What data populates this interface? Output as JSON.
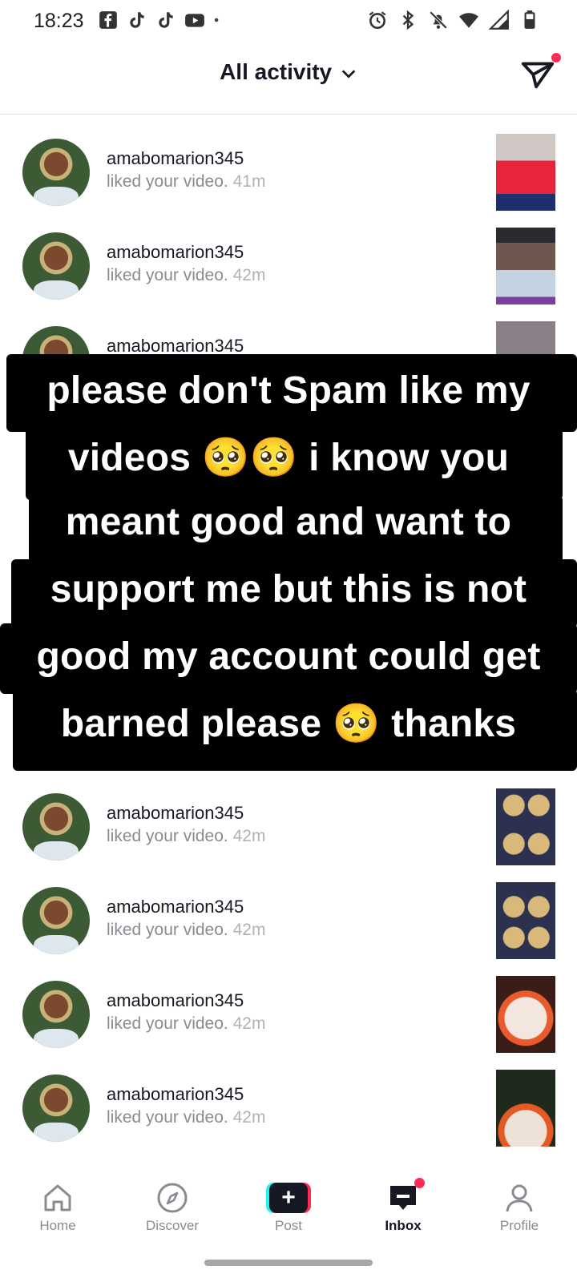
{
  "status": {
    "time": "18:23",
    "left_icons": [
      "facebook-icon",
      "tiktok-icon",
      "tiktok-icon",
      "youtube-icon",
      "dot-icon"
    ],
    "right_icons": [
      "alarm-icon",
      "bluetooth-icon",
      "mute-icon",
      "wifi-icon",
      "signal-icon",
      "battery-icon"
    ]
  },
  "header": {
    "title": "All activity"
  },
  "activity": [
    {
      "user": "amabomarion345",
      "action": "liked your video.",
      "time": "41m"
    },
    {
      "user": "amabomarion345",
      "action": "liked your video.",
      "time": "42m"
    },
    {
      "user": "amabomarion345",
      "action": "",
      "time": ""
    },
    {
      "user": "amabomarion345",
      "action": "liked your video.",
      "time": "42m"
    },
    {
      "user": "amabomarion345",
      "action": "liked your video.",
      "time": "42m"
    },
    {
      "user": "amabomarion345",
      "action": "liked your video.",
      "time": "42m"
    },
    {
      "user": "amabomarion345",
      "action": "liked your video.",
      "time": "42m"
    }
  ],
  "caption": {
    "lines": [
      "please don't Spam like my",
      "videos 🥺🥺 i know you",
      "meant good and want to",
      "support me but this is not",
      "good my account could get",
      "barned please 🥺 thanks"
    ]
  },
  "nav": {
    "home": "Home",
    "discover": "Discover",
    "post": "Post",
    "inbox": "Inbox",
    "profile": "Profile"
  },
  "colors": {
    "accent_red": "#fe2c55",
    "accent_cyan": "#25f4ee",
    "text_primary": "#161823",
    "text_secondary": "#8a8b91"
  }
}
